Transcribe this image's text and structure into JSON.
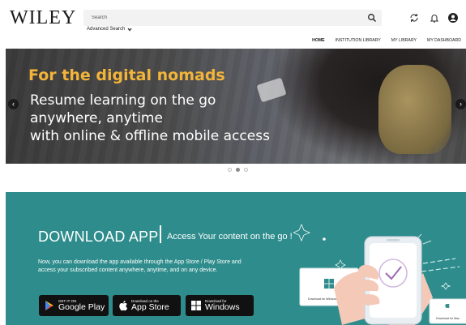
{
  "header": {
    "logo": "WILEY",
    "search_placeholder": "Search",
    "advanced_search": "Advanced Search",
    "nav": [
      "HOME",
      "INSTITUTION LIBRARY",
      "MY LIBRARY",
      "MY DASHBOARD"
    ]
  },
  "hero": {
    "title": "For the digital nomads",
    "lines": [
      "Resume learning on the go",
      "anywhere, anytime",
      "with online & offline mobile access"
    ],
    "slides": 3,
    "active_slide": 2
  },
  "app": {
    "title": "DOWNLOAD APP",
    "subtitle": "Access Your content on the go !",
    "description_1": "Now, you can download the app available through the App Store / Play Store and",
    "description_2": "access your subscribed content anywhere, anytime, and on any device.",
    "buttons": [
      {
        "small": "GET IT ON",
        "big": "Google Play"
      },
      {
        "small": "Download on the",
        "big": "App Store"
      },
      {
        "small": "Download for",
        "big": "Windows"
      }
    ],
    "illus_windows_label": "Download for Windows",
    "illus_mac_label": "Download for Mac"
  },
  "colors": {
    "accent_yellow": "#f3b43a",
    "teal": "#2e8c8c"
  }
}
